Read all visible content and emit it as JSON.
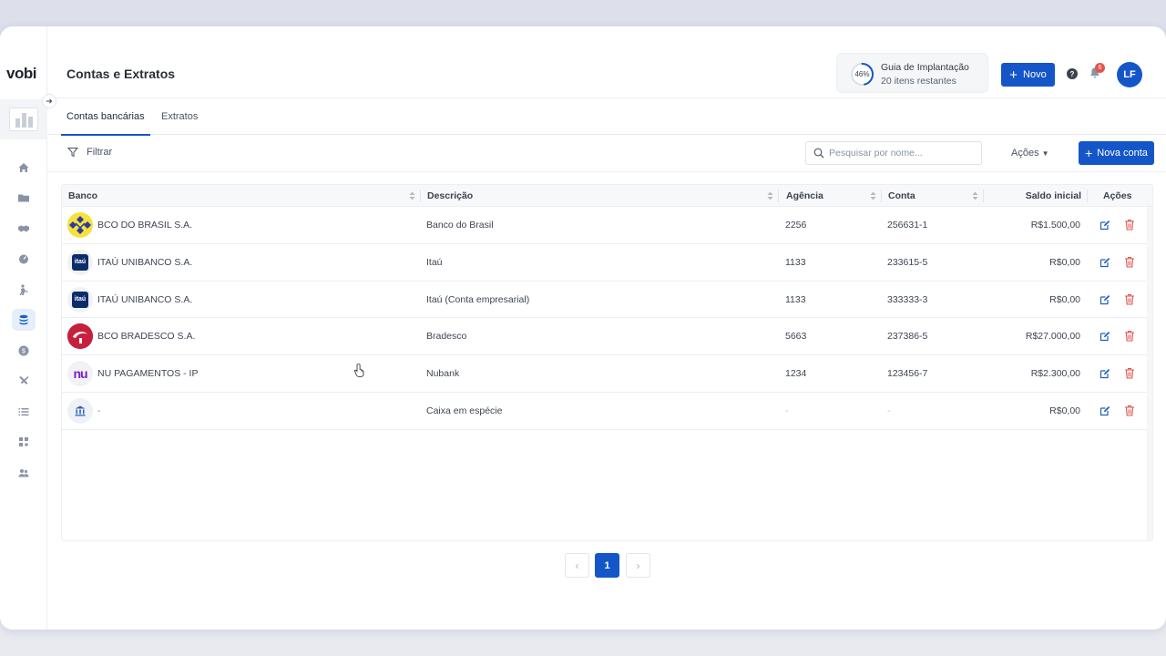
{
  "app": {
    "logo": "vobi"
  },
  "header": {
    "title": "Contas e Extratos",
    "guide": {
      "percent": "46%",
      "progress": 0.46,
      "title": "Guia de Implantação",
      "subtitle": "20 itens restantes"
    },
    "new_button": "Novo",
    "notifications_count": "6",
    "avatar_initials": "LF"
  },
  "sidebar": {
    "items": [
      {
        "icon": "home-icon",
        "active": false
      },
      {
        "icon": "folder-icon",
        "active": false
      },
      {
        "icon": "handshake-icon",
        "active": false
      },
      {
        "icon": "gauge-icon",
        "active": false
      },
      {
        "icon": "worker-icon",
        "active": false
      },
      {
        "icon": "coins-icon",
        "active": true
      },
      {
        "icon": "dollar-icon",
        "active": false
      },
      {
        "icon": "tools-icon",
        "active": false
      },
      {
        "icon": "list-icon",
        "active": false
      },
      {
        "icon": "apps-add-icon",
        "active": false
      },
      {
        "icon": "users-icon",
        "active": false
      }
    ]
  },
  "tabs": [
    {
      "label": "Contas bancárias",
      "active": true
    },
    {
      "label": "Extratos",
      "active": false
    }
  ],
  "toolbar": {
    "filter_label": "Filtrar",
    "search_placeholder": "Pesquisar por nome...",
    "actions_label": "Ações",
    "new_account_label": "Nova conta"
  },
  "table": {
    "columns": {
      "bank": "Banco",
      "description": "Descrição",
      "agency": "Agência",
      "account": "Conta",
      "balance": "Saldo inicial",
      "actions": "Ações"
    },
    "rows": [
      {
        "logo": "bb",
        "bank": "BCO DO BRASIL S.A.",
        "description": "Banco do Brasil",
        "agency": "2256",
        "account": "256631-1",
        "balance": "R$1.500,00"
      },
      {
        "logo": "itau",
        "bank": "ITAÚ UNIBANCO S.A.",
        "description": "Itaú",
        "agency": "1133",
        "account": "233615-5",
        "balance": "R$0,00"
      },
      {
        "logo": "itau",
        "bank": "ITAÚ UNIBANCO S.A.",
        "description": "Itaú (Conta empresarial)",
        "agency": "1133",
        "account": "333333-3",
        "balance": "R$0,00"
      },
      {
        "logo": "brad",
        "bank": "BCO BRADESCO S.A.",
        "description": "Bradesco",
        "agency": "5663",
        "account": "237386-5",
        "balance": "R$27.000,00"
      },
      {
        "logo": "nu",
        "bank": "NU PAGAMENTOS - IP",
        "description": "Nubank",
        "agency": "1234",
        "account": "123456-7",
        "balance": "R$2.300,00"
      },
      {
        "logo": "cash",
        "bank": "-",
        "description": "Caixa em espécie",
        "agency": "-",
        "account": "-",
        "balance": "R$0,00"
      }
    ],
    "logo_text": {
      "itau": "itaú",
      "nu": "nu"
    }
  },
  "pagination": {
    "current": "1"
  },
  "colors": {
    "primary": "#1456c8",
    "danger": "#e0534b",
    "badge": "#e5534b"
  }
}
